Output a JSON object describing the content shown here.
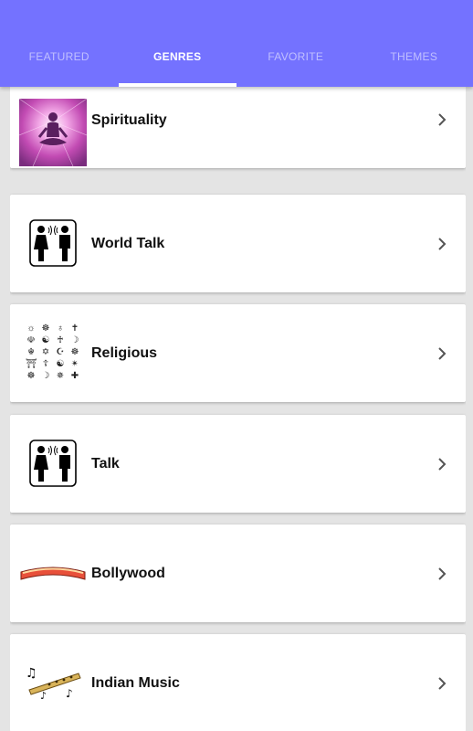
{
  "tabs": [
    {
      "label": "FEATURED"
    },
    {
      "label": "GENRES"
    },
    {
      "label": "FAVORITE"
    },
    {
      "label": "THEMES"
    }
  ],
  "active_tab": "GENRES",
  "genres": [
    {
      "name": "Spirituality",
      "icon": "meditation-icon"
    },
    {
      "name": "World Talk",
      "icon": "talk-people-icon"
    },
    {
      "name": "Religious",
      "icon": "religious-symbols-icon"
    },
    {
      "name": "Talk",
      "icon": "talk-people-icon"
    },
    {
      "name": "Bollywood",
      "icon": "bollywood-logo-icon"
    },
    {
      "name": "Indian Music",
      "icon": "flute-music-icon"
    }
  ],
  "religious_symbols": [
    "☼",
    "☸",
    "♁",
    "✝",
    "☫",
    "☯",
    "♰",
    "☽",
    "☬",
    "✡",
    "☪",
    "☸",
    "⛩",
    "☦",
    "☯",
    "✴",
    "☸",
    "☽",
    "✵",
    "✚"
  ],
  "colors": {
    "appbar": "#7472ff",
    "background": "#e4e4e4",
    "card": "#ffffff"
  }
}
